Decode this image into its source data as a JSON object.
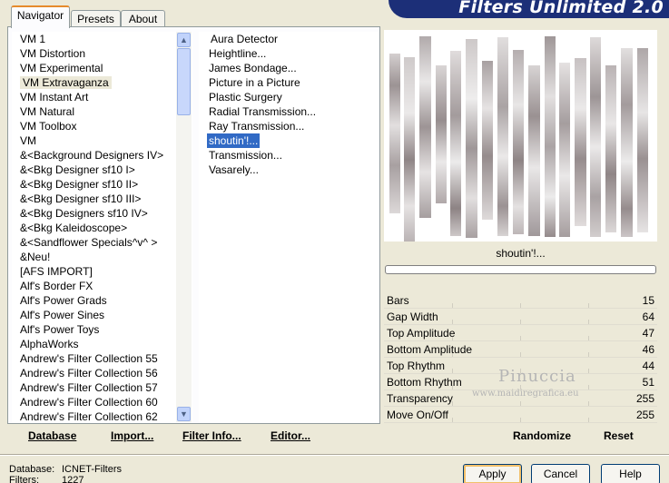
{
  "tabs": [
    "Navigator",
    "Presets",
    "About"
  ],
  "categories": [
    "VM 1",
    "VM Distortion",
    "VM Experimental",
    "VM Extravaganza",
    "VM Instant Art",
    "VM Natural",
    "VM Toolbox",
    "VM",
    "&<Background Designers IV>",
    "&<Bkg Designer sf10 I>",
    "&<Bkg Designer sf10 II>",
    "&<Bkg Designer sf10 III>",
    "&<Bkg Designers sf10 IV>",
    "&<Bkg Kaleidoscope>",
    "&<Sandflower Specials^v^ >",
    "&Neu!",
    "[AFS IMPORT]",
    "Alf's Border FX",
    "Alf's Power Grads",
    "Alf's Power Sines",
    "Alf's Power Toys",
    "AlphaWorks",
    "Andrew's Filter Collection 55",
    "Andrew's Filter Collection 56",
    "Andrew's Filter Collection 57",
    "Andrew's Filter Collection 60",
    "Andrew's Filter Collection 62"
  ],
  "selected_category": "VM Extravaganza",
  "filters": [
    "Aura Detector",
    "Heightline...",
    "James Bondage...",
    "Picture in a Picture",
    "Plastic Surgery",
    "Radial Transmission...",
    "Ray Transmission...",
    "shoutin'!...",
    "Transmission...",
    "Vasarely..."
  ],
  "selected_filter": "shoutin'!...",
  "bottom_links": {
    "database": "Database",
    "import": "Import...",
    "filter_info": "Filter Info...",
    "editor": "Editor..."
  },
  "title": "Filters Unlimited 2.0",
  "preview_name": "shoutin'!...",
  "params": [
    {
      "label": "Bars",
      "value": "15"
    },
    {
      "label": "Gap Width",
      "value": "64"
    },
    {
      "label": "Top Amplitude",
      "value": "47"
    },
    {
      "label": "Bottom Amplitude",
      "value": "46"
    },
    {
      "label": "Top Rhythm",
      "value": "44"
    },
    {
      "label": "Bottom Rhythm",
      "value": "51"
    },
    {
      "label": "Transparency",
      "value": "255"
    },
    {
      "label": "Move On/Off",
      "value": "255"
    }
  ],
  "watermark": {
    "name": "Pinuccia",
    "site": "www.maidiregrafica.eu"
  },
  "actions": {
    "randomize": "Randomize",
    "reset": "Reset"
  },
  "info": {
    "database_label": "Database:",
    "database_value": "ICNET-Filters",
    "filters_label": "Filters:",
    "filters_value": "1227"
  },
  "buttons": {
    "apply": "Apply",
    "cancel": "Cancel",
    "help": "Help"
  },
  "icons": {
    "scroll_up": "scroll-up-arrow-icon",
    "scroll_down": "scroll-down-arrow-icon"
  },
  "colors": {
    "title_banner": "#1c2f78",
    "selection": "#316ac5",
    "tab_accent": "#e68b2c"
  }
}
